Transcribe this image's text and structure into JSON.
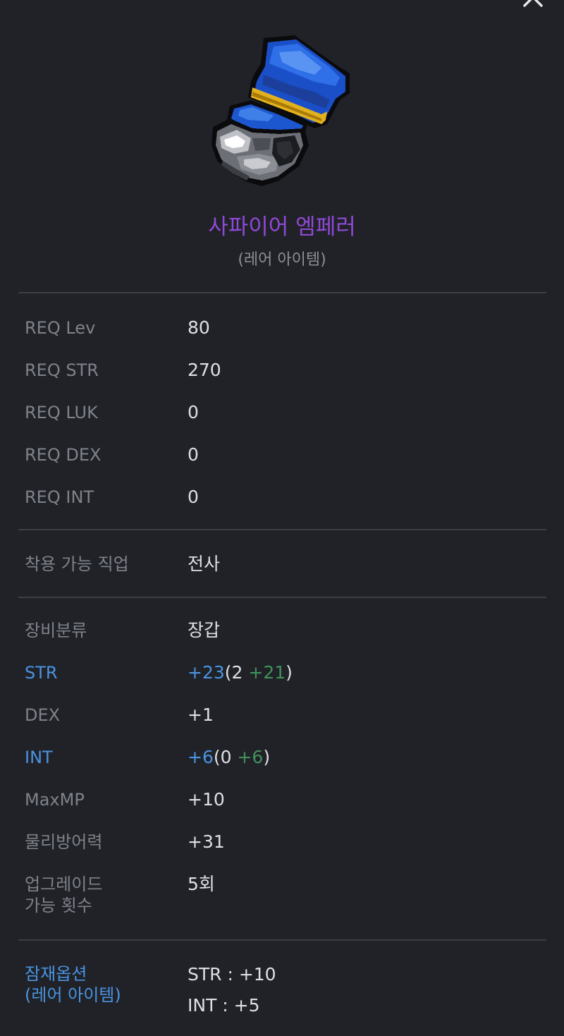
{
  "item": {
    "name": "사파이어 엠페러",
    "rarity": "(레어 아이템)",
    "icon": "sapphire-emperor-glove-icon"
  },
  "requirements": [
    {
      "label": "REQ Lev",
      "value": "80"
    },
    {
      "label": "REQ STR",
      "value": "270"
    },
    {
      "label": "REQ LUK",
      "value": "0"
    },
    {
      "label": "REQ DEX",
      "value": "0"
    },
    {
      "label": "REQ INT",
      "value": "0"
    }
  ],
  "job": {
    "label": "착용 가능 직업",
    "value": "전사"
  },
  "stats": {
    "category": {
      "label": "장비분류",
      "value": "장갑"
    },
    "str": {
      "label": "STR",
      "total": "+23",
      "open": "(2",
      "bonus": "+21",
      "close": ")"
    },
    "dex": {
      "label": "DEX",
      "value": "+1"
    },
    "int": {
      "label": "INT",
      "total": "+6",
      "open": "(0",
      "bonus": "+6",
      "close": ")"
    },
    "maxmp": {
      "label": "MaxMP",
      "value": "+10"
    },
    "def": {
      "label": "물리방어력",
      "value": "+31"
    },
    "upgrade": {
      "label_line1": "업그레이드",
      "label_line2": "가능 횟수",
      "value": "5회"
    }
  },
  "potential": {
    "label_line1": "잠재옵션",
    "label_line2": "(레어 아이템)",
    "lines": [
      "STR : +10",
      "INT : +5"
    ]
  },
  "colors": {
    "background": "#202228",
    "item_name": "#8f49d6",
    "highlight_blue": "#4a93e0",
    "bonus_green": "#41915a"
  }
}
